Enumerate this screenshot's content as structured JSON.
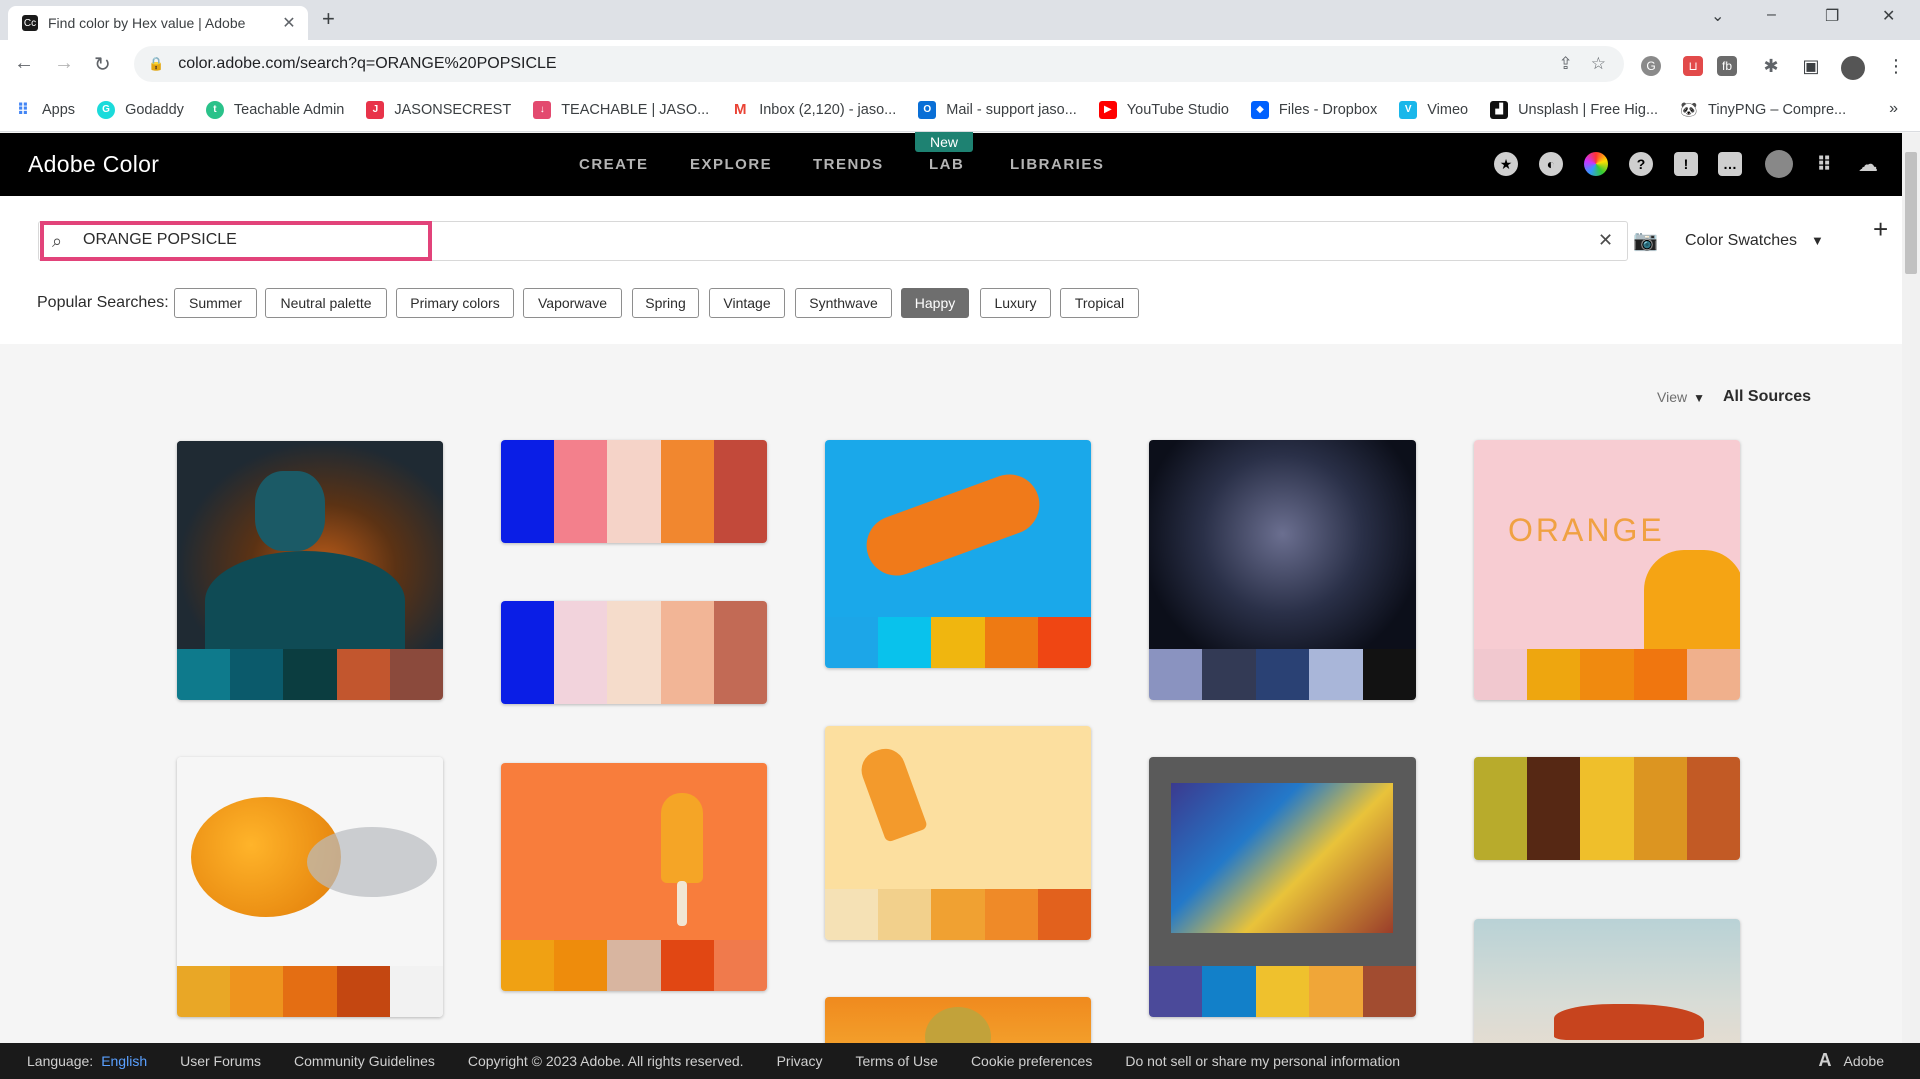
{
  "browser": {
    "tab_title": "Find color by Hex value | Adobe",
    "url": "color.adobe.com/search?q=ORANGE%20POPSICLE",
    "bookmarks": [
      {
        "label": "Apps",
        "color": "#4285f4"
      },
      {
        "label": "Godaddy",
        "color": "#1bdbdb"
      },
      {
        "label": "Teachable Admin",
        "color": "#2ac28a"
      },
      {
        "label": "JASONSECREST",
        "color": "#e8334a"
      },
      {
        "label": "TEACHABLE | JASO...",
        "color": "#e34a6f"
      },
      {
        "label": "Inbox (2,120) - jaso...",
        "color": "#ea4335"
      },
      {
        "label": "Mail - support jaso...",
        "color": "#0a6fd6"
      },
      {
        "label": "YouTube Studio",
        "color": "#ff0000"
      },
      {
        "label": "Files - Dropbox",
        "color": "#0061fe"
      },
      {
        "label": "Vimeo",
        "color": "#1ab7ea"
      },
      {
        "label": "Unsplash | Free Hig...",
        "color": "#111111"
      },
      {
        "label": "TinyPNG – Compre...",
        "color": "#444444"
      }
    ],
    "more": "»"
  },
  "header": {
    "brand": "Adobe Color",
    "nav": [
      "CREATE",
      "EXPLORE",
      "TRENDS",
      "LAB",
      "LIBRARIES"
    ],
    "new_badge": "New"
  },
  "search": {
    "query": "ORANGE POPSICLE",
    "filter_label": "Color Swatches",
    "popular_label": "Popular Searches:",
    "popular": [
      "Summer",
      "Neutral palette",
      "Primary colors",
      "Vaporwave",
      "Spring",
      "Vintage",
      "Synthwave",
      "Happy",
      "Luxury",
      "Tropical"
    ],
    "active_popular": "Happy"
  },
  "results": {
    "view_label": "View",
    "source_label": "All Sources",
    "orange_text": "ORANGE",
    "cards": [
      {
        "kind": "image",
        "swatches": [
          "#0e7a8c",
          "#0b5a6b",
          "#0b3d40",
          "#c2562e",
          "#8b4a3c"
        ]
      },
      {
        "kind": "palette",
        "swatches": [
          "#0a1ee6",
          "#f3808c",
          "#f5d3c8",
          "#f1872f",
          "#c2493a"
        ]
      },
      {
        "kind": "palette",
        "swatches": [
          "#0a1ee6",
          "#f2d3dc",
          "#f5dccb",
          "#f2b596",
          "#c26a55"
        ]
      },
      {
        "kind": "image",
        "swatches": [
          "#1ca6e8",
          "#09c2ec",
          "#f0b60f",
          "#ee7a13",
          "#ef4613"
        ]
      },
      {
        "kind": "image",
        "swatches": [
          "#8a93c0",
          "#333a55",
          "#2a4174",
          "#a9b6d9",
          "#121212"
        ]
      },
      {
        "kind": "image",
        "swatches": [
          "#f1c8cf",
          "#eea60f",
          "#f08a0f",
          "#f0760f",
          "#f0b08c"
        ]
      },
      {
        "kind": "image",
        "swatches": [
          "#e9a726",
          "#ee941e",
          "#e46e13",
          "#c44711",
          "#f2f2f2"
        ]
      },
      {
        "kind": "image",
        "swatches": [
          "#f0a113",
          "#ee8c0c",
          "#d8b5a0",
          "#e14713",
          "#f07a4c"
        ]
      },
      {
        "kind": "image",
        "swatches": [
          "#f5e1b5",
          "#f2d08c",
          "#f0a132",
          "#ef8a28",
          "#e2611d"
        ]
      },
      {
        "kind": "image",
        "swatches": [
          "#4b4a9a",
          "#1280c9",
          "#efc12d",
          "#f0a638",
          "#a24c30"
        ]
      },
      {
        "kind": "palette",
        "swatches": [
          "#b8ab2c",
          "#562814",
          "#efbf2b",
          "#dc9521",
          "#c25a25"
        ]
      },
      {
        "kind": "image",
        "swatches": []
      },
      {
        "kind": "image",
        "swatches": []
      }
    ]
  },
  "footer": {
    "language_label": "Language:",
    "language_value": "English",
    "links": [
      "User Forums",
      "Community Guidelines",
      "Copyright © 2023 Adobe. All rights reserved.",
      "Privacy",
      "Terms of Use",
      "Cookie preferences",
      "Do not sell or share my personal information"
    ],
    "adobe": "Adobe"
  }
}
